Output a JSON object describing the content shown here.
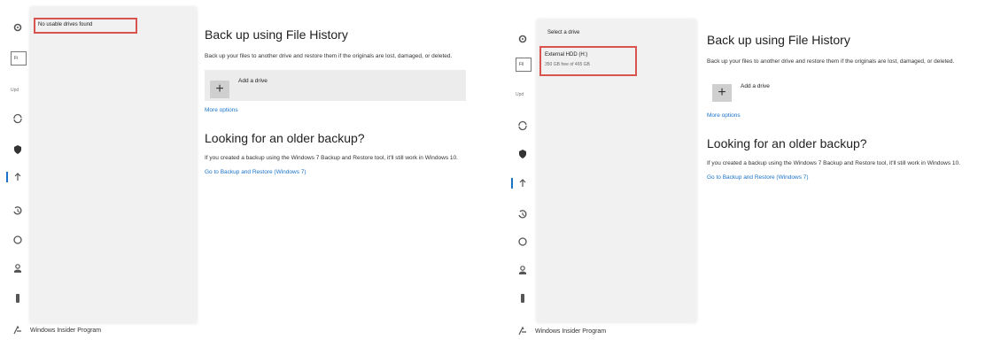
{
  "left": {
    "nav_search_text": "Fi",
    "nav_heading": "Upd",
    "footer_label": "Windows Insider Program",
    "flyout_message": "No usable drives found",
    "content": {
      "title": "Back up using File History",
      "description": "Back up your files to another drive and restore them if the originals are lost, damaged, or deleted.",
      "add_drive_label": "Add a drive",
      "more_options": "More options",
      "older_title": "Looking for an older backup?",
      "older_description": "If you created a backup using the Windows 7 Backup and Restore tool, it'll still work in Windows 10.",
      "restore_link": "Go to Backup and Restore (Windows 7)"
    }
  },
  "right": {
    "nav_search_text": "Fil",
    "nav_heading": "Upd",
    "footer_label": "Windows Insider Program",
    "flyout_header": "Select a drive",
    "drive_name": "External HDD (H:)",
    "drive_space": "350 GB free of 465 GB",
    "content": {
      "title": "Back up using File History",
      "description": "Back up your files to another drive and restore them if the originals are lost, damaged, or deleted.",
      "add_drive_label": "Add a drive",
      "more_options": "More options",
      "older_title": "Looking for an older backup?",
      "older_description": "If you created a backup using the Windows 7 Backup and Restore tool, it'll still work in Windows 10.",
      "restore_link": "Go to Backup and Restore (Windows 7)"
    }
  },
  "colors": {
    "accent": "#1a73c8",
    "highlight": "#d9534f",
    "flyout_bg": "#f1f1f1"
  },
  "icons": [
    "settings-gear-icon",
    "sync-icon",
    "shield-icon",
    "backup-arrow-icon",
    "history-icon",
    "circle-icon",
    "person-icon",
    "key-icon",
    "insider-icon"
  ]
}
